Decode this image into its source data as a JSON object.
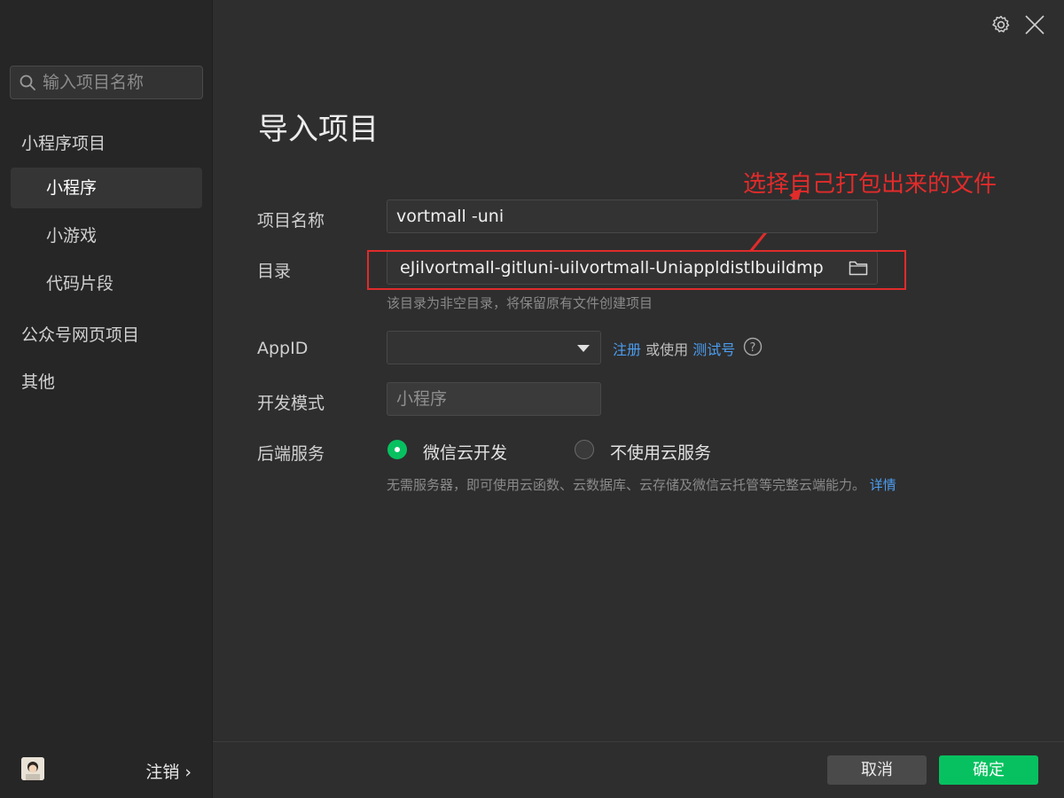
{
  "sidebar": {
    "search_placeholder": "输入项目名称",
    "group_miniprogram": "小程序项目",
    "items": [
      {
        "label": "小程序"
      },
      {
        "label": "小游戏"
      },
      {
        "label": "代码片段"
      }
    ],
    "group_official": "公众号网页项目",
    "group_other": "其他",
    "logout_label": "注销 ›"
  },
  "header": {
    "title": "导入项目"
  },
  "form": {
    "name_label": "项目名称",
    "name_value": "vortmall -uni",
    "dir_label": "目录",
    "dir_value": "eJilvortmall-gitluni-uilvortmall-Uniappldistlbuildmp",
    "dir_hint": "该目录为非空目录，将保留原有文件创建项目",
    "appid_label": "AppID",
    "appid_value": "",
    "appid_register": "注册",
    "appid_or_use": " 或使用 ",
    "appid_test": "测试号",
    "mode_label": "开发模式",
    "mode_value": "小程序",
    "backend_label": "后端服务",
    "backend_options": [
      {
        "label": "微信云开发",
        "selected": true
      },
      {
        "label": "不使用云服务",
        "selected": false
      }
    ],
    "backend_desc": "无需服务器，即可使用云函数、云数据库、云存储及微信云托管等完整云端能力。",
    "backend_detail_link": "详情"
  },
  "annotation": {
    "text": "选择自己打包出来的文件",
    "color": "#e22b2b"
  },
  "footer": {
    "cancel_label": "取消",
    "confirm_label": "确定"
  },
  "colors": {
    "accent": "#07c160",
    "link": "#4c9df0"
  },
  "icons": [
    "search-icon",
    "gear-icon",
    "close-icon",
    "folder-icon",
    "chevron-down-icon",
    "help-icon",
    "avatar"
  ]
}
